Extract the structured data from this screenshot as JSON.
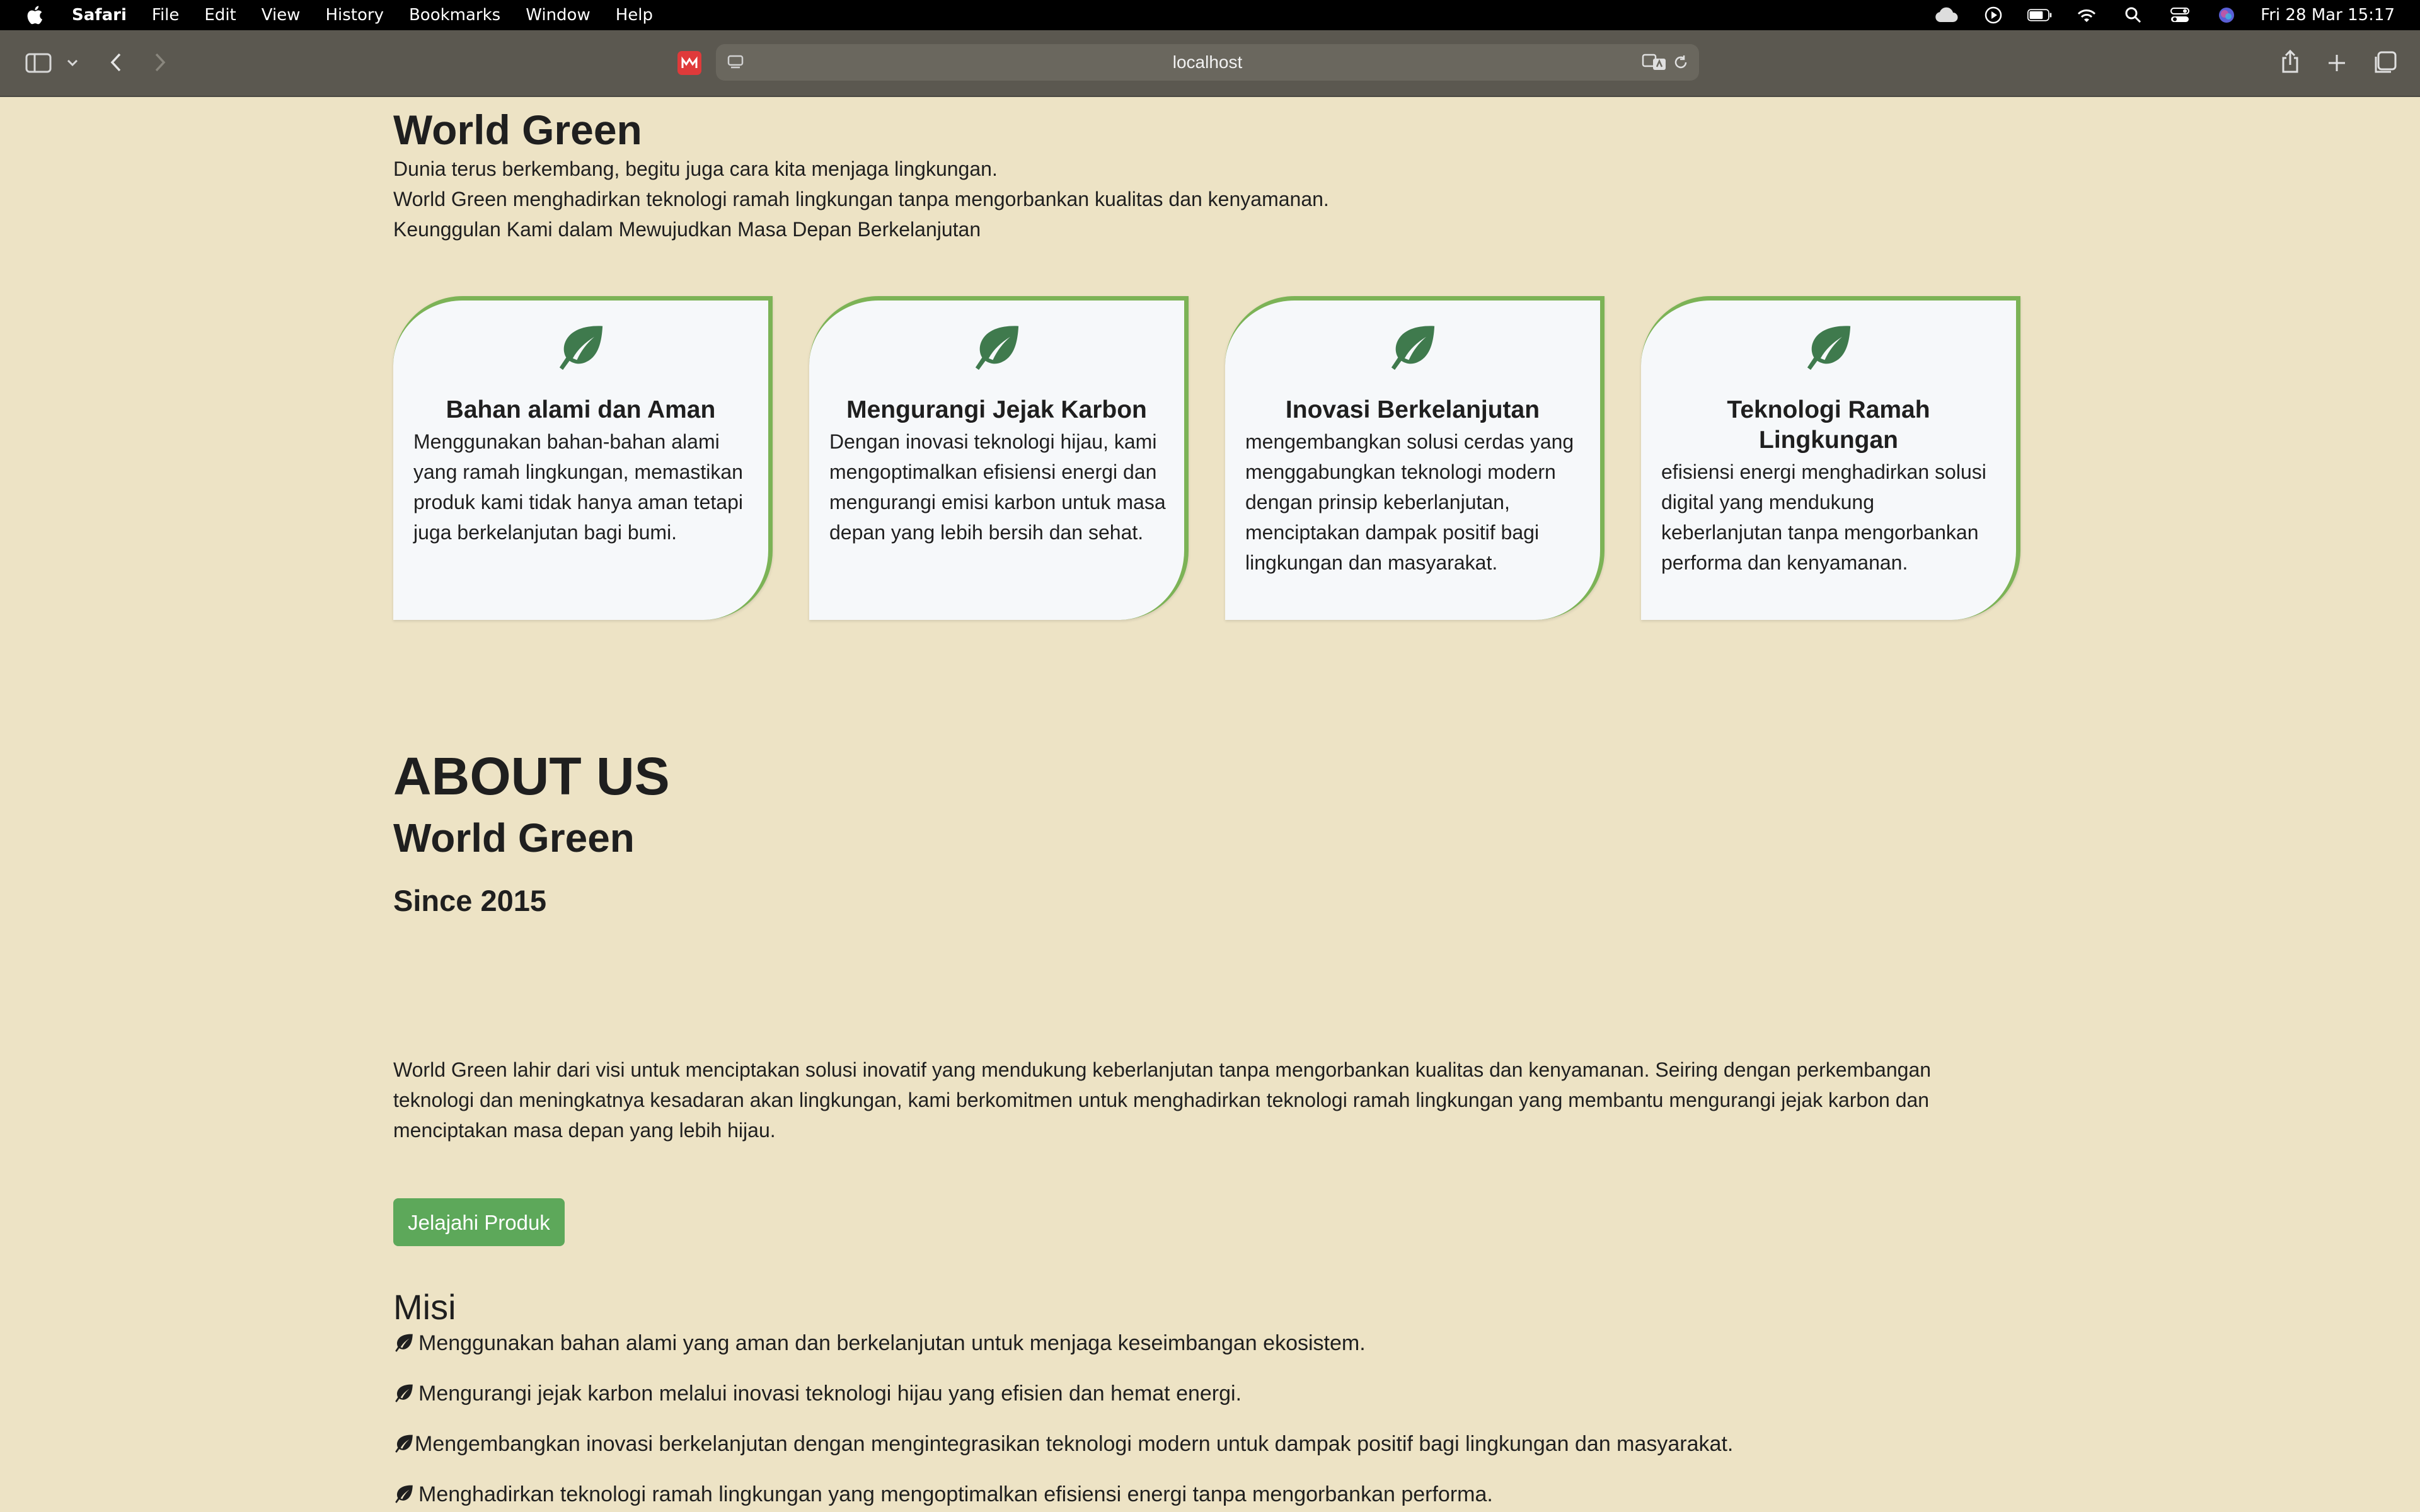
{
  "menubar": {
    "app_name": "Safari",
    "items": [
      "File",
      "Edit",
      "View",
      "History",
      "Bookmarks",
      "Window",
      "Help"
    ],
    "clock": "Fri 28 Mar  15:17"
  },
  "browser": {
    "url": "localhost"
  },
  "hero": {
    "title": "World Green",
    "lines": [
      "Dunia terus berkembang, begitu juga cara kita menjaga lingkungan.",
      "World Green menghadirkan teknologi ramah lingkungan tanpa mengorbankan kualitas dan kenyamanan.",
      "Keunggulan Kami dalam Mewujudkan Masa Depan Berkelanjutan"
    ]
  },
  "features": [
    {
      "icon": "leaf-icon",
      "title": "Bahan alami dan Aman",
      "text": "Menggunakan bahan-bahan alami yang ramah lingkungan, memastikan produk kami tidak hanya aman tetapi juga berkelanjutan bagi bumi."
    },
    {
      "icon": "leaf-icon",
      "title": "Mengurangi Jejak Karbon",
      "text": "Dengan inovasi teknologi hijau, kami mengoptimalkan efisiensi energi dan mengurangi emisi karbon untuk masa depan yang lebih bersih dan sehat."
    },
    {
      "icon": "leaf-icon",
      "title": "Inovasi Berkelanjutan",
      "text": "mengembangkan solusi cerdas yang menggabungkan teknologi modern dengan prinsip keberlanjutan, menciptakan dampak positif bagi lingkungan dan masyarakat."
    },
    {
      "icon": "leaf-icon",
      "title": "Teknologi Ramah Lingkungan",
      "text": "efisiensi energi menghadirkan solusi digital yang mendukung keberlanjutan tanpa mengorbankan performa dan kenyamanan."
    }
  ],
  "about": {
    "title": "ABOUT US",
    "subtitle": "World Green",
    "since": "Since 2015",
    "text": "World Green lahir dari visi untuk menciptakan solusi inovatif yang mendukung keberlanjutan tanpa mengorbankan kualitas dan kenyamanan. Seiring dengan perkembangan teknologi dan meningkatnya kesadaran akan lingkungan, kami berkomitmen untuk menghadirkan teknologi ramah lingkungan yang membantu mengurangi jejak karbon dan menciptakan masa depan yang lebih hijau.",
    "cta_label": "Jelajahi Produk"
  },
  "misi": {
    "title": "Misi",
    "items": [
      "Menggunakan bahan alami yang aman dan berkelanjutan untuk menjaga keseimbangan ekosistem.",
      "Mengurangi jejak karbon melalui inovasi teknologi hijau yang efisien dan hemat energi.",
      "Mengembangkan inovasi berkelanjutan dengan mengintegrasikan teknologi modern untuk dampak positif bagi lingkungan dan masyarakat.",
      "Menghadirkan teknologi ramah lingkungan yang mengoptimalkan efisiensi energi tanpa mengorbankan performa."
    ]
  },
  "colors": {
    "page_background": "#ede3c5",
    "card_accent": "#7cb356",
    "leaf_icon": "#3f7a4d",
    "button": "#5da85a"
  }
}
